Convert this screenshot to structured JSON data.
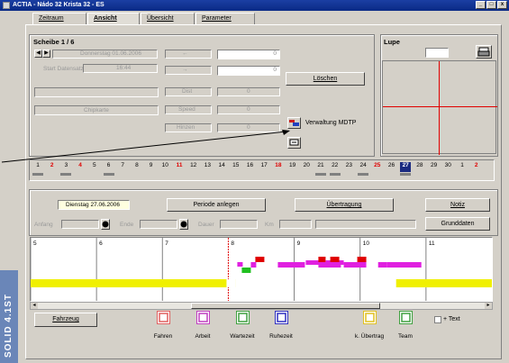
{
  "window": {
    "title": "ACTIA - Nádo 32 Krista 32 - ES",
    "controls": [
      "_",
      "□",
      "x"
    ]
  },
  "tabs": [
    {
      "label": "Zeitraum",
      "active": false
    },
    {
      "label": "Ansicht",
      "active": true
    },
    {
      "label": "Übersicht",
      "active": false
    },
    {
      "label": "Parameter",
      "active": false
    }
  ],
  "scheibe": {
    "title": "Scheibe  1 / 6",
    "date": "Donnerstag 01.06.2006",
    "start_label": "Start Datensatz",
    "start_value": "16:44",
    "card_label": "Chipkarte",
    "field1_label": "←",
    "field2_label": "→",
    "dist_label": "Dist",
    "dist_value": "0",
    "speed_label": "Speed",
    "speed_value": "0",
    "km_label": "Hinzen",
    "km_value": "0",
    "value1": "0",
    "value2": "0",
    "delete_label": "Löschen",
    "mdtp_label": "Verwaltung MDTP"
  },
  "lupe": {
    "title": "Lupe"
  },
  "days": [
    "1",
    "2",
    "3",
    "4",
    "5",
    "6",
    "7",
    "8",
    "9",
    "10",
    "11",
    "12",
    "13",
    "14",
    "15",
    "16",
    "17",
    "18",
    "19",
    "20",
    "21",
    "22",
    "23",
    "24",
    "25",
    "26",
    "27",
    "28",
    "29",
    "30",
    "1",
    "2"
  ],
  "days_red": [
    "4",
    "11",
    "18",
    "25",
    "2"
  ],
  "selected_day": "27",
  "period": {
    "date": "Dienstag 27.06.2006",
    "create_label": "Periode anlegen",
    "transfer_label": "Übertragung",
    "notiz_label": "Notiz",
    "grunddaten_label": "Grunddaten",
    "anfang_label": "Anfang",
    "ende_label": "Ende",
    "dauer_label": "Dauer",
    "km_label": "Km"
  },
  "timeline": {
    "hours": [
      "5",
      "6",
      "7",
      "8",
      "9",
      "10",
      "11"
    ],
    "colors": {
      "yellow": "#f0f000",
      "magenta": "#e020e0",
      "red": "#e00000",
      "green": "#20c020"
    }
  },
  "legend": {
    "vehicle_label": "Fahrzeug",
    "items": [
      {
        "name": "fahren",
        "label": "Fahren",
        "color": "#e06060"
      },
      {
        "name": "arbeit",
        "label": "Arbeit",
        "color": "#c040c0"
      },
      {
        "name": "wartezeit",
        "label": "Wartezeit",
        "color": "#40a040"
      },
      {
        "name": "ruhezeit",
        "label": "Ruhezeit",
        "color": "#3030c0"
      },
      {
        "name": "k-ubertrag",
        "label": "k. Übertrag",
        "color": "#e0c020"
      },
      {
        "name": "team",
        "label": "Team",
        "color": "#40a040"
      }
    ],
    "text_label": "+ Text"
  },
  "brand": "SOLID 4.1ST"
}
